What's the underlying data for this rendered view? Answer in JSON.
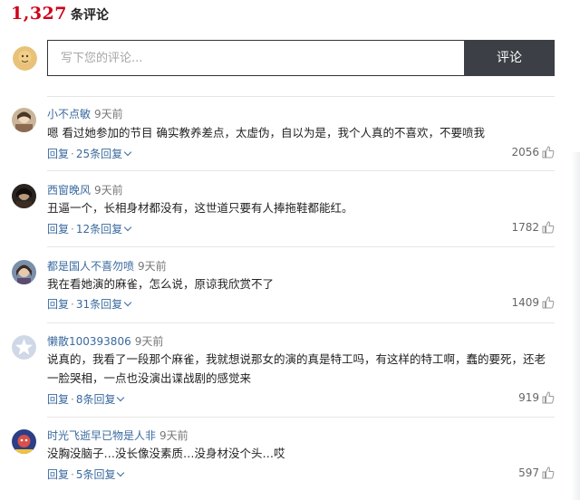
{
  "header": {
    "count": "1,327",
    "label": "条评论"
  },
  "compose": {
    "placeholder": "写下您的评论...",
    "submit_label": "评论"
  },
  "comments": [
    {
      "user": "小不点敏",
      "time": "9天前",
      "text": "嗯 看过她参加的节目 确实教养差点，太虚伪，自以为是，我个人真的不喜欢，不要喷我",
      "reply_label": "回复",
      "replies_label": "25条回复",
      "likes": "2056"
    },
    {
      "user": "西窗晚风",
      "time": "9天前",
      "text": "丑逼一个，长相身材都没有，这世道只要有人捧拖鞋都能红。",
      "reply_label": "回复",
      "replies_label": "12条回复",
      "likes": "1782"
    },
    {
      "user": "都是国人不喜勿喷",
      "time": "9天前",
      "text": "我在看她演的麻雀，怎么说，原谅我欣赏不了",
      "reply_label": "回复",
      "replies_label": "31条回复",
      "likes": "1409"
    },
    {
      "user": "懒散100393806",
      "time": "9天前",
      "text": "说真的，我看了一段那个麻雀，我就想说那女的演的真是特工吗，有这样的特工啊，蠢的要死，还老一脸哭相，一点也没演出谍战剧的感觉来",
      "reply_label": "回复",
      "replies_label": "8条回复",
      "likes": "919"
    },
    {
      "user": "时光飞逝早已物是人非",
      "time": "9天前",
      "text": "没胸没脑子…没长像没素质…没身材没个头…哎",
      "reply_label": "回复",
      "replies_label": "5条回复",
      "likes": "597"
    }
  ],
  "colors": {
    "count": "#d0021b",
    "link": "#3a6a9e",
    "button_bg": "#3c3f46"
  },
  "icons": {
    "like": "thumbs-up-icon"
  }
}
